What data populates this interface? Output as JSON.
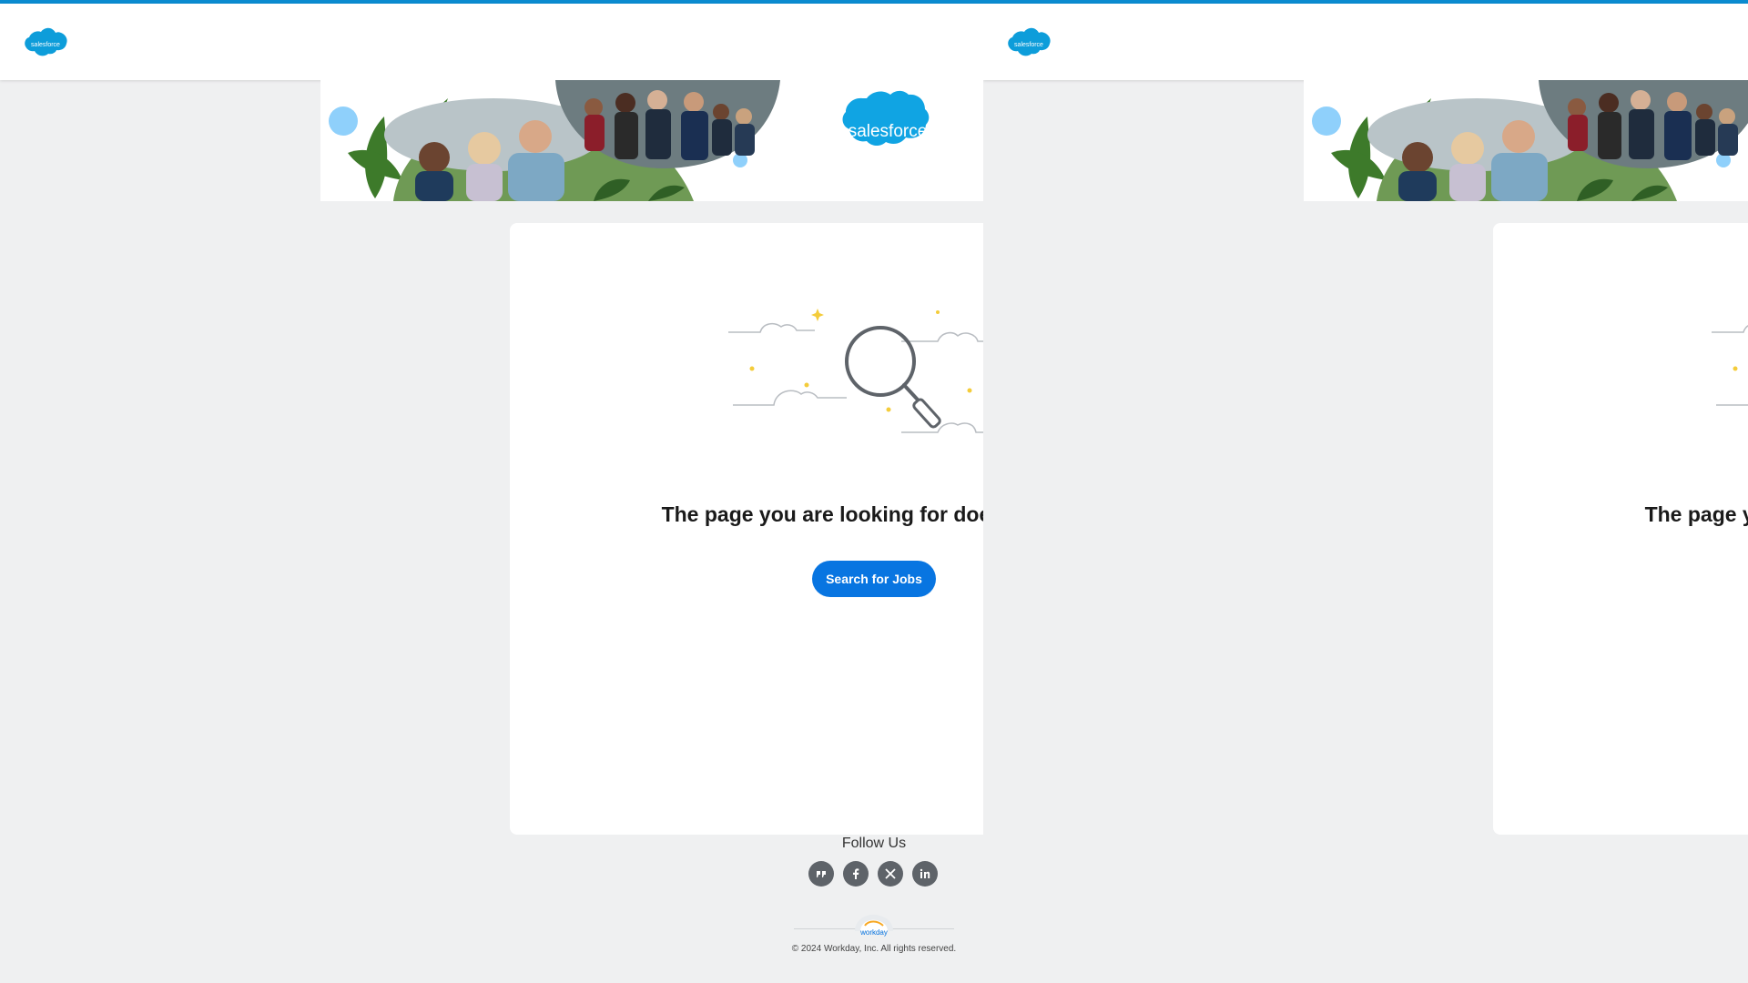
{
  "brand": {
    "logo_text": "salesforce",
    "banner_logo_text": "salesforce",
    "accent_color": "#0b8bd0",
    "button_color": "#0875e1"
  },
  "error_page": {
    "message": "The page you are looking for doesn't exist.",
    "illustration_icon": "magnifying-glass-icon",
    "search_button_label": "Search for Jobs"
  },
  "footer": {
    "follow_label": "Follow Us",
    "socials": [
      {
        "name": "blog-icon",
        "glyph": "❞"
      },
      {
        "name": "facebook-icon",
        "glyph": "f"
      },
      {
        "name": "x-icon",
        "glyph": "✕"
      },
      {
        "name": "linkedin-icon",
        "glyph": "in"
      }
    ],
    "powered_by_logo_text": "workday",
    "copyright": "© 2024 Workday, Inc. All rights reserved."
  }
}
